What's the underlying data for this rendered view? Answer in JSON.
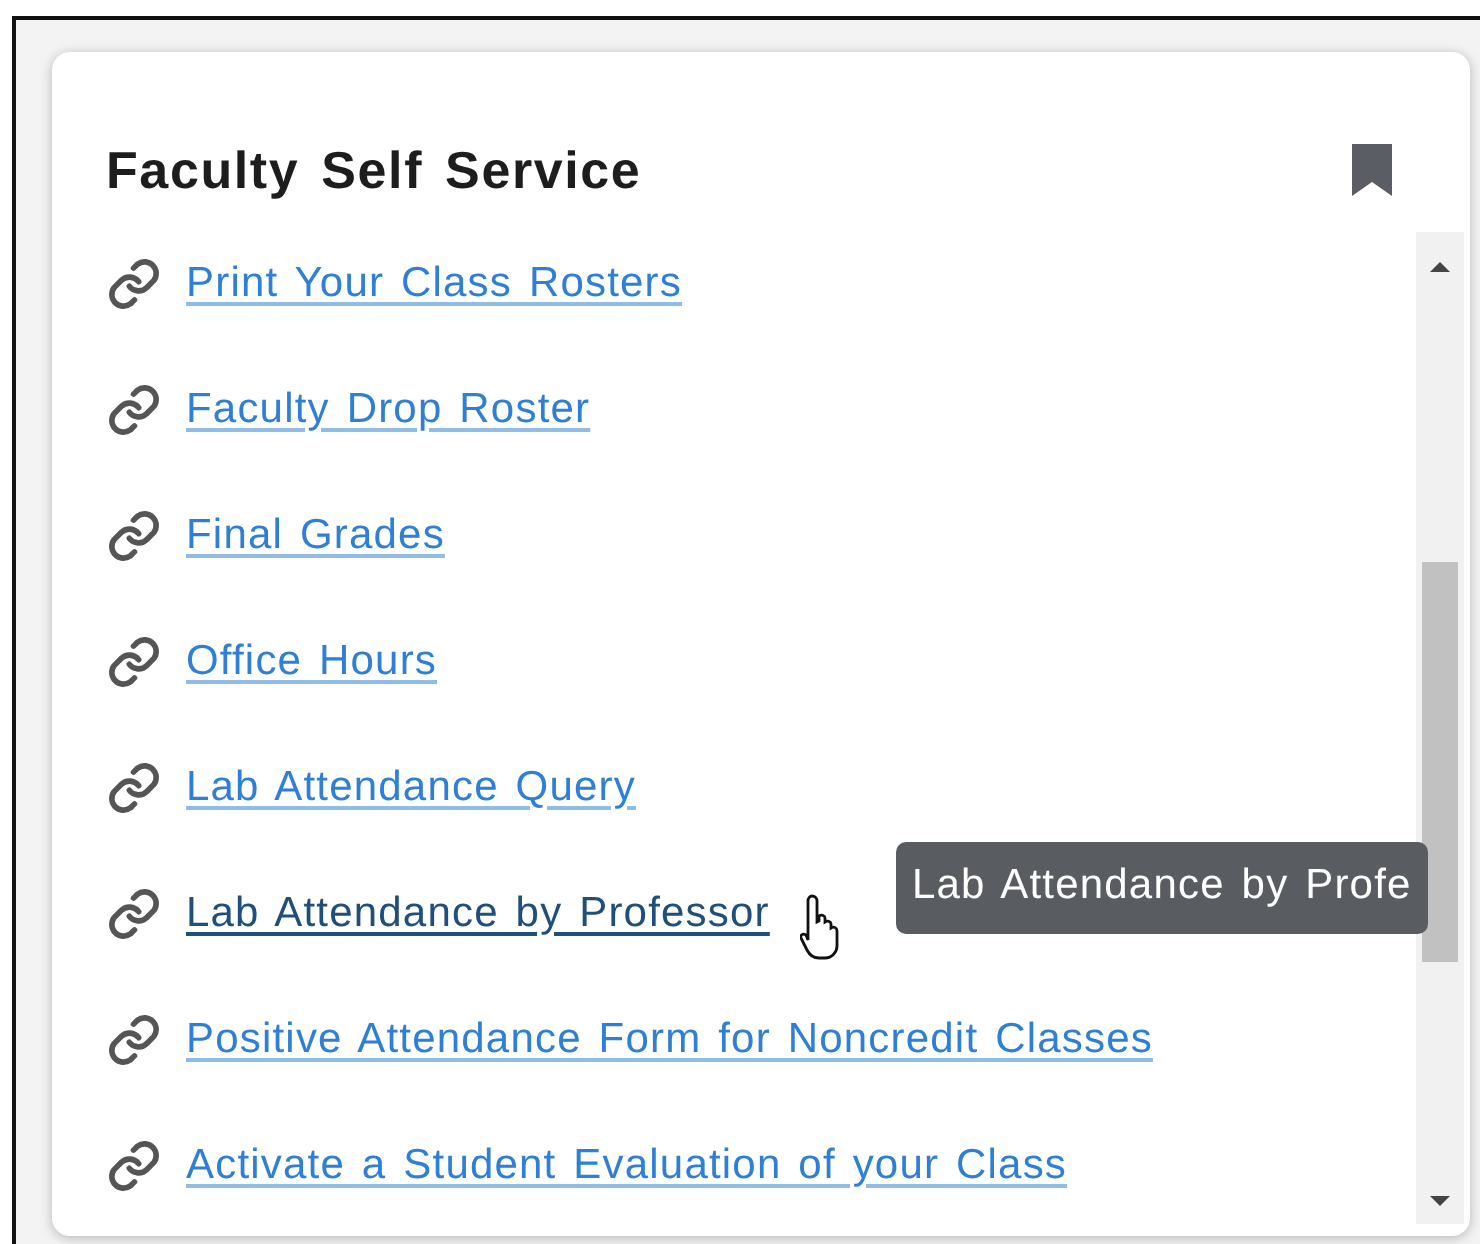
{
  "card": {
    "title": "Faculty Self Service",
    "links": [
      {
        "label": "Print Your Class Rosters",
        "hovered": false
      },
      {
        "label": "Faculty Drop Roster",
        "hovered": false
      },
      {
        "label": "Final Grades",
        "hovered": false
      },
      {
        "label": "Office Hours",
        "hovered": false
      },
      {
        "label": "Lab Attendance Query",
        "hovered": false
      },
      {
        "label": "Lab Attendance by Professor",
        "hovered": true
      },
      {
        "label": "Positive Attendance Form for Noncredit Classes",
        "hovered": false
      },
      {
        "label": "Activate a Student Evaluation of your Class",
        "hovered": false
      }
    ],
    "tooltip": {
      "text": "Lab Attendance by Profe"
    }
  }
}
